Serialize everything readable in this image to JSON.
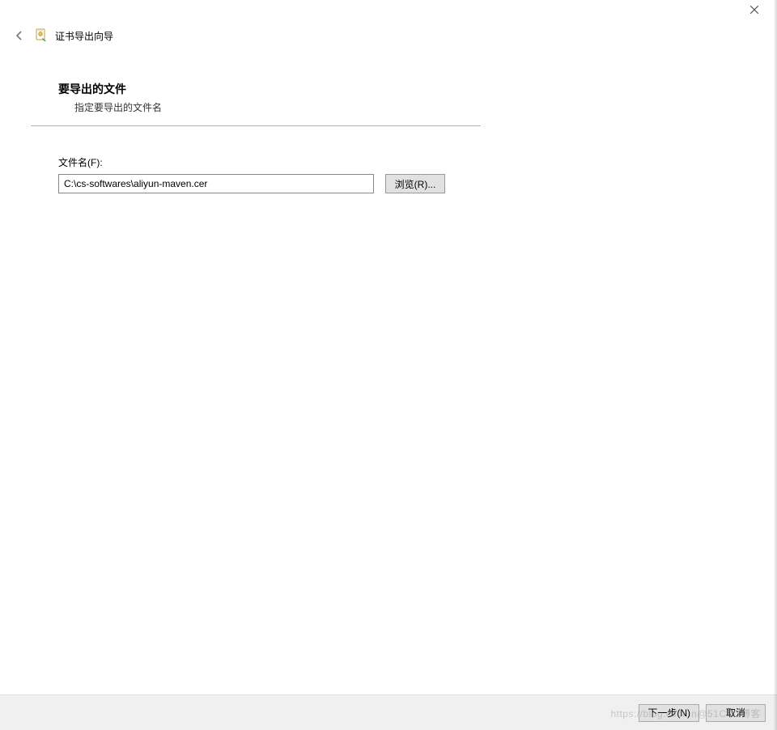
{
  "window": {
    "title": "证书导出向导"
  },
  "section": {
    "title": "要导出的文件",
    "subtitle": "指定要导出的文件名"
  },
  "file_field": {
    "label": "文件名(F):",
    "value": "C:\\cs-softwares\\aliyun-maven.cer",
    "browse_label": "浏览(R)..."
  },
  "footer": {
    "next_label": "下一步(N)",
    "cancel_label": "取消"
  },
  "watermark": "https://blog.csdn.n@51CTO博客"
}
